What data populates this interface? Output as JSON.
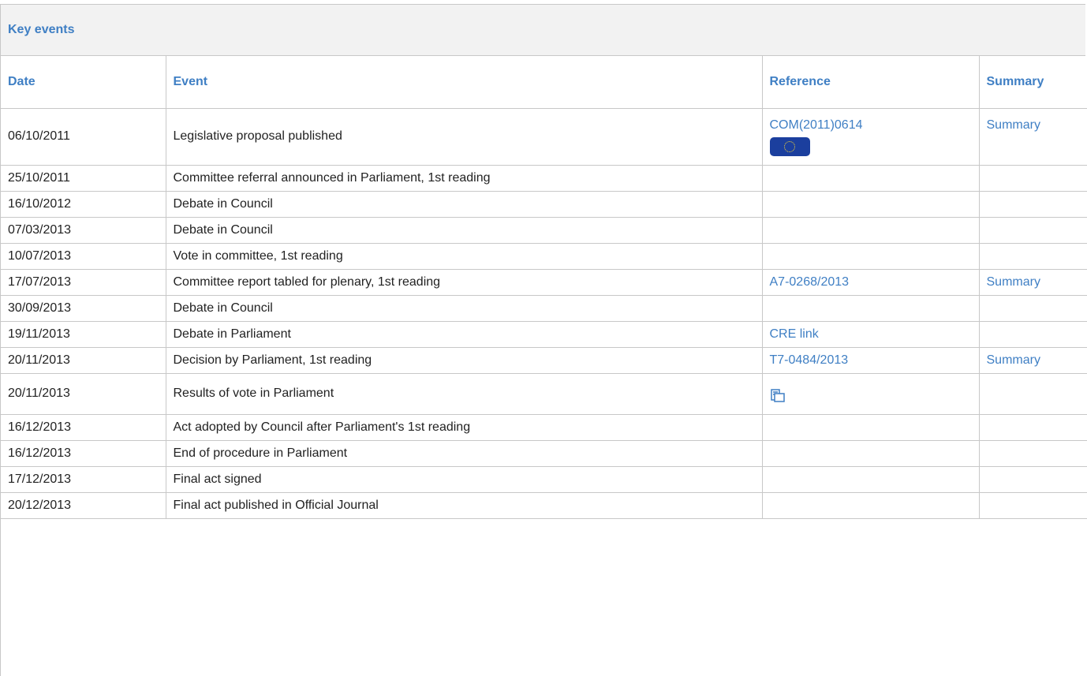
{
  "panel": {
    "title": "Key events"
  },
  "columns": {
    "date": "Date",
    "event": "Event",
    "reference": "Reference",
    "summary": "Summary"
  },
  "rows": [
    {
      "date": "06/10/2011",
      "event": "Legislative proposal published",
      "reference": "COM(2011)0614",
      "summary": "Summary"
    },
    {
      "date": "25/10/2011",
      "event": "Committee referral announced in Parliament, 1st reading",
      "reference": "",
      "summary": ""
    },
    {
      "date": "16/10/2012",
      "event": "Debate in Council",
      "reference": "",
      "summary": ""
    },
    {
      "date": "07/03/2013",
      "event": "Debate in Council",
      "reference": "",
      "summary": ""
    },
    {
      "date": "10/07/2013",
      "event": "Vote in committee, 1st reading",
      "reference": "",
      "summary": ""
    },
    {
      "date": "17/07/2013",
      "event": "Committee report tabled for plenary, 1st reading",
      "reference": "A7-0268/2013",
      "summary": "Summary"
    },
    {
      "date": "30/09/2013",
      "event": "Debate in Council",
      "reference": "",
      "summary": ""
    },
    {
      "date": "19/11/2013",
      "event": "Debate in Parliament",
      "reference": "CRE link",
      "summary": ""
    },
    {
      "date": "20/11/2013",
      "event": "Decision by Parliament, 1st reading",
      "reference": "T7-0484/2013",
      "summary": "Summary"
    },
    {
      "date": "20/11/2013",
      "event": "Results of vote in Parliament",
      "reference": "",
      "summary": ""
    },
    {
      "date": "16/12/2013",
      "event": "Act adopted by Council after Parliament's 1st reading",
      "reference": "",
      "summary": ""
    },
    {
      "date": "16/12/2013",
      "event": "End of procedure in Parliament",
      "reference": "",
      "summary": ""
    },
    {
      "date": "17/12/2013",
      "event": "Final act signed",
      "reference": "",
      "summary": ""
    },
    {
      "date": "20/12/2013",
      "event": "Final act published in Official Journal",
      "reference": "",
      "summary": ""
    }
  ],
  "icons": {
    "eu_flag": "eu-flag-icon",
    "vote_results": "vote-results-icon"
  },
  "colors": {
    "link": "#3f7fc4",
    "header_bg": "#f2f2f2",
    "border": "#c8c8c8"
  }
}
